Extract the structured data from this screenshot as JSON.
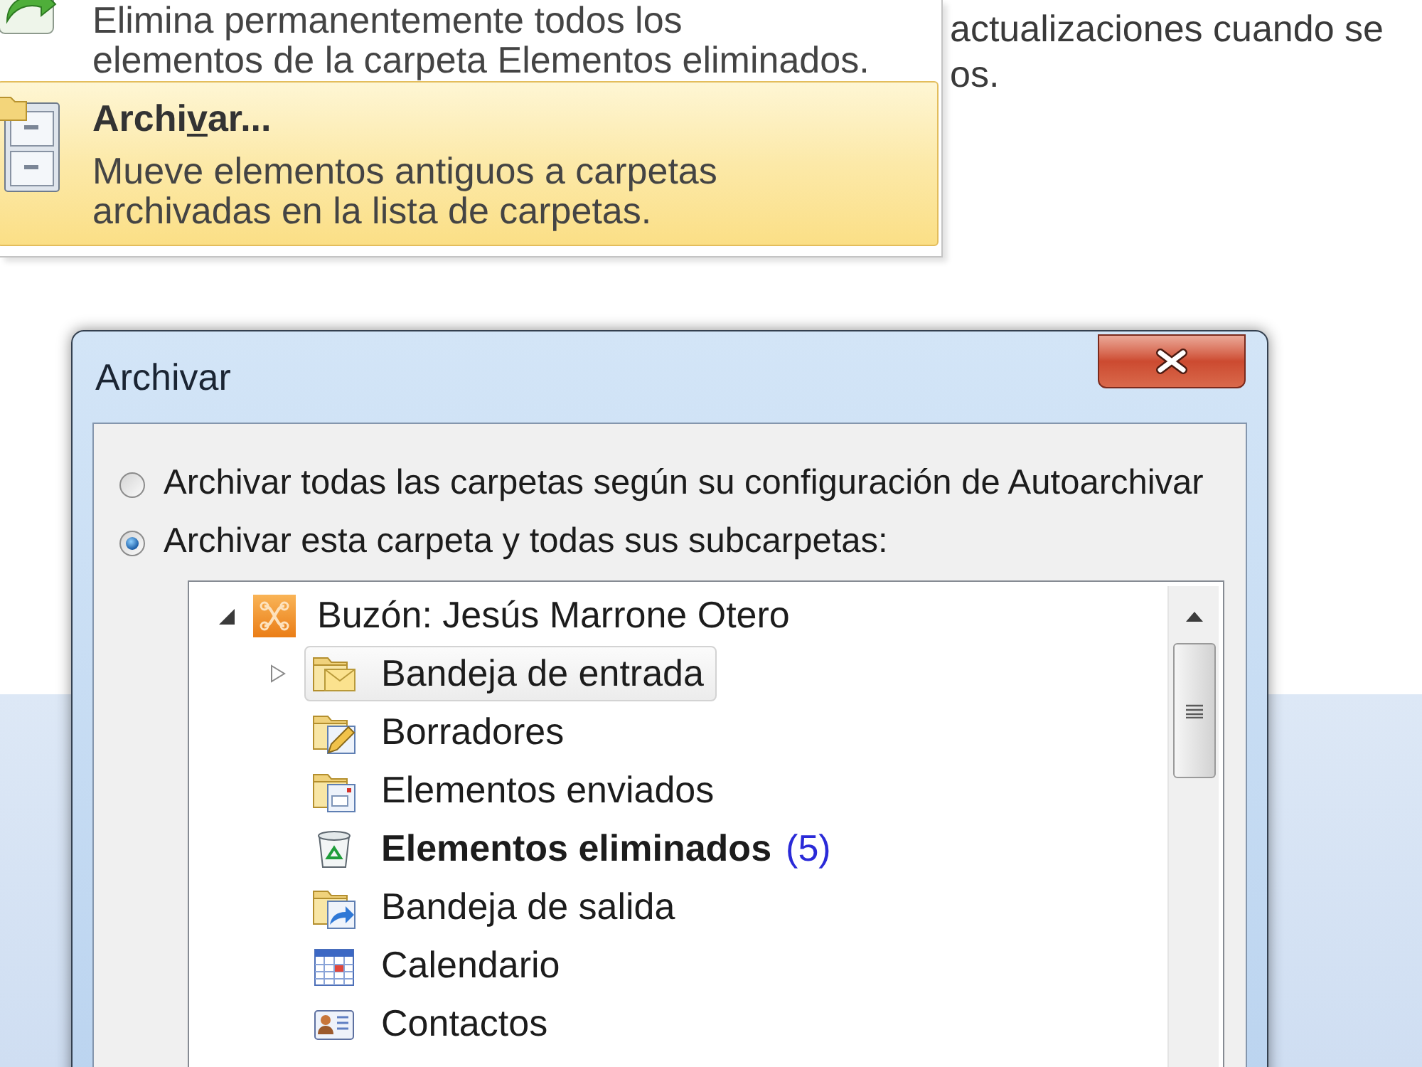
{
  "menu": {
    "items": [
      {
        "kind": "cleanup",
        "selected": false,
        "description_lines": [
          "Elimina permanentemente todos los",
          "elementos de la carpeta Elementos eliminados."
        ]
      },
      {
        "kind": "archive",
        "selected": true,
        "title_before": "Archi",
        "access_key": "v",
        "title_after": "ar...",
        "description_lines": [
          "Mueve elementos antiguos a carpetas",
          "archivadas en la lista de carpetas."
        ]
      }
    ]
  },
  "background_text": {
    "lines": [
      "actualizaciones cuando se",
      "os."
    ]
  },
  "dialog": {
    "title": "Archivar",
    "radios": [
      {
        "label": "Archivar todas las carpetas según su configuración de Autoarchivar",
        "selected": false
      },
      {
        "label": "Archivar esta carpeta y todas sus subcarpetas:",
        "selected": true
      }
    ],
    "folder_tree": {
      "label": "Buzón: Jesús Marrone Otero",
      "expanded": true,
      "selected": false,
      "children": [
        {
          "label": "Bandeja de entrada",
          "kind": "inbox",
          "expanded": false,
          "selected": true,
          "unread": false
        },
        {
          "label": "Borradores",
          "kind": "drafts",
          "selected": false,
          "unread": false
        },
        {
          "label": "Elementos enviados",
          "kind": "sent",
          "selected": false,
          "unread": false
        },
        {
          "label": "Elementos eliminados",
          "kind": "deleted",
          "selected": false,
          "unread": true,
          "count": "(5)"
        },
        {
          "label": "Bandeja de salida",
          "kind": "outbox",
          "selected": false,
          "unread": false
        },
        {
          "label": "Calendario",
          "kind": "calendar",
          "selected": false,
          "unread": false
        },
        {
          "label": "Contactos",
          "kind": "contacts",
          "selected": false,
          "unread": false
        }
      ]
    }
  }
}
